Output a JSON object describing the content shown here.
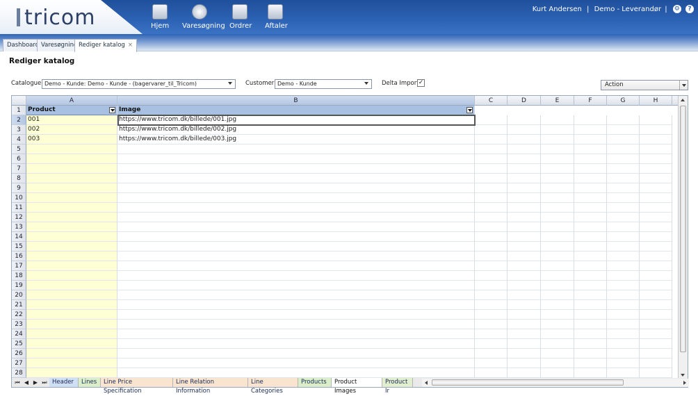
{
  "app": {
    "logo": "tricom"
  },
  "nav": [
    {
      "label": "Hjem",
      "icon": "home-icon"
    },
    {
      "label": "Varesøgning",
      "icon": "magnifier-icon"
    },
    {
      "label": "Ordrer",
      "icon": "orders-icon"
    },
    {
      "label": "Aftaler",
      "icon": "agreements-icon"
    }
  ],
  "user": {
    "name": "Kurt Andersen",
    "sep1": "|",
    "company": "Demo - Leverandør",
    "sep2": "|"
  },
  "tabs": [
    {
      "label": "Dashboard"
    },
    {
      "label": "Varesøgning"
    },
    {
      "label": "Rediger katalog",
      "close": "×"
    }
  ],
  "page": {
    "title": "Rediger katalog"
  },
  "filters": {
    "catalogue_label": "Catalogue:",
    "catalogue_value": "Demo - Kunde: Demo - Kunde - (bagervarer_til_Tricom)",
    "customer_label": "Customer:",
    "customer_value": "Demo - Kunde",
    "delta_label": "Delta Import:",
    "delta_checked": "✓",
    "action_value": "Action"
  },
  "sheet": {
    "columns": [
      "A",
      "B",
      "C",
      "D",
      "E",
      "F",
      "G",
      "H"
    ],
    "rows": [
      "1",
      "2",
      "3",
      "4",
      "5",
      "6",
      "7",
      "8",
      "9",
      "10",
      "11",
      "12",
      "13",
      "14",
      "15",
      "16",
      "17",
      "18",
      "19",
      "20",
      "21",
      "22",
      "23",
      "24",
      "25",
      "26",
      "27",
      "28"
    ],
    "header": {
      "product": "Product",
      "image": "Image"
    },
    "data": [
      {
        "product": "001",
        "image": "https://www.tricom.dk/billede/001.jpg"
      },
      {
        "product": "002",
        "image": "https://www.tricom.dk/billede/002.jpg"
      },
      {
        "product": "003",
        "image": "https://www.tricom.dk/billede/003.jpg"
      }
    ]
  },
  "sheet_tabs": [
    "Header",
    "Lines",
    "Line Price Specification",
    "Line Relation Information",
    "Line Categories",
    "Products",
    "Product Images",
    "Product Ir"
  ],
  "sheet_nav": [
    "⏮",
    "◀",
    "▶",
    "⏭"
  ]
}
